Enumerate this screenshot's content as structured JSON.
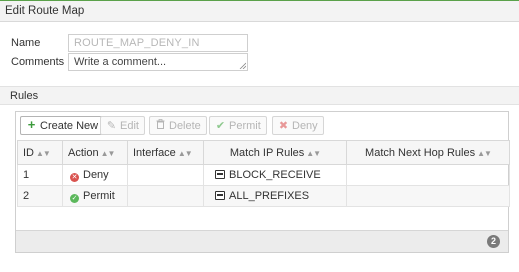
{
  "window": {
    "title": "Edit Route Map"
  },
  "form": {
    "name_label": "Name",
    "name_value": "ROUTE_MAP_DENY_IN",
    "comments_label": "Comments",
    "comments_placeholder": "Write a comment..."
  },
  "rules": {
    "section_title": "Rules",
    "toolbar": {
      "create_new": "Create New",
      "edit": "Edit",
      "delete": "Delete",
      "permit": "Permit",
      "deny": "Deny"
    },
    "columns": [
      "ID",
      "Action",
      "Interface",
      "Match IP Rules",
      "Match Next Hop Rules"
    ],
    "rows": [
      {
        "id": "1",
        "action": "Deny",
        "action_icon": "deny-icon",
        "interface": "",
        "match_ip": "BLOCK_RECEIVE",
        "match_next_hop": ""
      },
      {
        "id": "2",
        "action": "Permit",
        "action_icon": "permit-icon",
        "interface": "",
        "match_ip": "ALL_PREFIXES",
        "match_next_hop": ""
      }
    ],
    "row_count": "2"
  },
  "colors": {
    "accent_green": "#3c9a3c",
    "deny_red": "#d9534f",
    "permit_green": "#5cb85c"
  }
}
